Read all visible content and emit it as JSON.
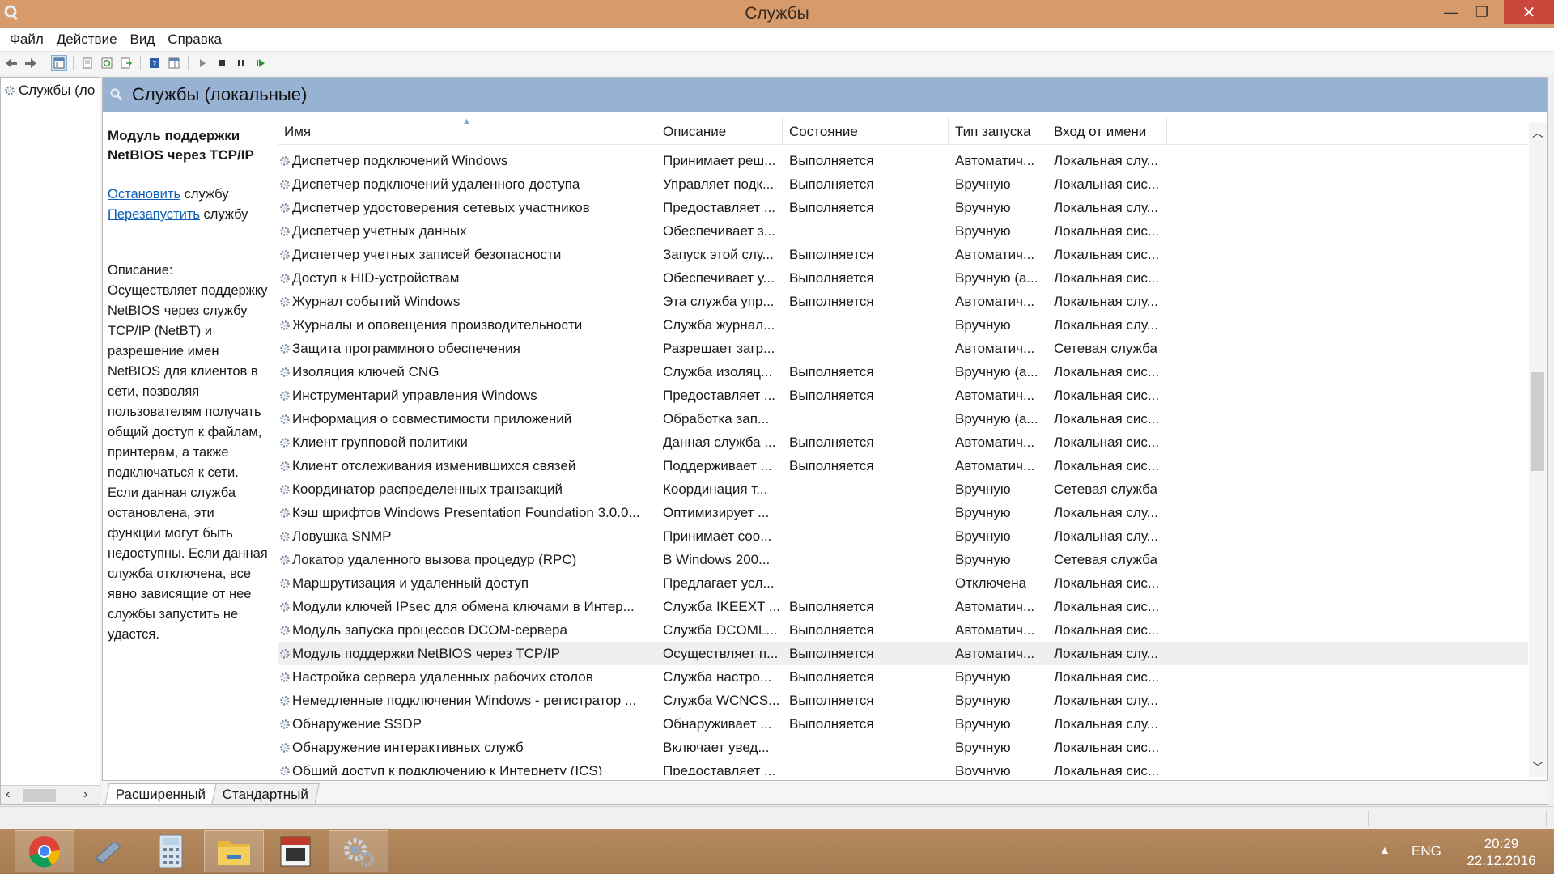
{
  "window": {
    "title": "Службы",
    "minimize_glyph": "—",
    "maximize_glyph": "❐",
    "close_glyph": "✕"
  },
  "menu": [
    "Файл",
    "Действие",
    "Вид",
    "Справка"
  ],
  "tree": {
    "item_label": "Службы (ло"
  },
  "main": {
    "header_title": "Службы (локальные)",
    "selected_service_title": "Модуль поддержки NetBIOS через TCP/IP",
    "stop_link": "Остановить",
    "stop_suffix": " службу",
    "restart_link": "Перезапустить",
    "restart_suffix": " службу",
    "description_label": "Описание:",
    "description_text": "Осуществляет поддержку NetBIOS через службу TCP/IP (NetBT) и разрешение имен NetBIOS для клиентов в сети, позволяя пользователям получать общий доступ к файлам, принтерам, а также подключаться к сети. Если данная служба остановлена, эти функции могут быть недоступны. Если данная служба отключена, все явно зависящие от нее службы запустить не удастся."
  },
  "table": {
    "columns": [
      "Имя",
      "Описание",
      "Состояние",
      "Тип запуска",
      "Вход от имени"
    ],
    "rows": [
      [
        "Диспетчер подключений Windows",
        "Принимает реш...",
        "Выполняется",
        "Автоматич...",
        "Локальная слу..."
      ],
      [
        "Диспетчер подключений удаленного доступа",
        "Управляет подк...",
        "Выполняется",
        "Вручную",
        "Локальная сис..."
      ],
      [
        "Диспетчер удостоверения сетевых участников",
        "Предоставляет ...",
        "Выполняется",
        "Вручную",
        "Локальная слу..."
      ],
      [
        "Диспетчер учетных данных",
        "Обеспечивает з...",
        "",
        "Вручную",
        "Локальная сис..."
      ],
      [
        "Диспетчер учетных записей безопасности",
        "Запуск этой слу...",
        "Выполняется",
        "Автоматич...",
        "Локальная сис..."
      ],
      [
        "Доступ к HID-устройствам",
        "Обеспечивает у...",
        "Выполняется",
        "Вручную (а...",
        "Локальная сис..."
      ],
      [
        "Журнал событий Windows",
        "Эта служба упр...",
        "Выполняется",
        "Автоматич...",
        "Локальная слу..."
      ],
      [
        "Журналы и оповещения производительности",
        "Служба журнал...",
        "",
        "Вручную",
        "Локальная слу..."
      ],
      [
        "Защита программного обеспечения",
        "Разрешает загр...",
        "",
        "Автоматич...",
        "Сетевая служба"
      ],
      [
        "Изоляция ключей CNG",
        "Служба изоляц...",
        "Выполняется",
        "Вручную (а...",
        "Локальная сис..."
      ],
      [
        "Инструментарий управления Windows",
        "Предоставляет ...",
        "Выполняется",
        "Автоматич...",
        "Локальная сис..."
      ],
      [
        "Информация о совместимости приложений",
        "Обработка зап...",
        "",
        "Вручную (а...",
        "Локальная сис..."
      ],
      [
        "Клиент групповой политики",
        "Данная служба ...",
        "Выполняется",
        "Автоматич...",
        "Локальная сис..."
      ],
      [
        "Клиент отслеживания изменившихся связей",
        "Поддерживает ...",
        "Выполняется",
        "Автоматич...",
        "Локальная сис..."
      ],
      [
        "Координатор распределенных транзакций",
        "Координация т...",
        "",
        "Вручную",
        "Сетевая служба"
      ],
      [
        "Кэш шрифтов Windows Presentation Foundation 3.0.0...",
        "Оптимизирует ...",
        "",
        "Вручную",
        "Локальная слу..."
      ],
      [
        "Ловушка SNMP",
        "Принимает соо...",
        "",
        "Вручную",
        "Локальная слу..."
      ],
      [
        "Локатор удаленного вызова процедур (RPC)",
        "В Windows 200...",
        "",
        "Вручную",
        "Сетевая служба"
      ],
      [
        "Маршрутизация и удаленный доступ",
        "Предлагает усл...",
        "",
        "Отключена",
        "Локальная сис..."
      ],
      [
        "Модули ключей IPsec для обмена ключами в Интер...",
        "Служба IKEEXT ...",
        "Выполняется",
        "Автоматич...",
        "Локальная сис..."
      ],
      [
        "Модуль запуска процессов DCOM-сервера",
        "Служба DCOML...",
        "Выполняется",
        "Автоматич...",
        "Локальная сис..."
      ],
      [
        "Модуль поддержки NetBIOS через TCP/IP",
        "Осуществляет п...",
        "Выполняется",
        "Автоматич...",
        "Локальная слу..."
      ],
      [
        "Настройка сервера удаленных рабочих столов",
        "Служба настро...",
        "Выполняется",
        "Вручную",
        "Локальная сис..."
      ],
      [
        "Немедленные подключения Windows - регистратор ...",
        "Служба WCNCS...",
        "Выполняется",
        "Вручную",
        "Локальная слу..."
      ],
      [
        "Обнаружение SSDP",
        "Обнаруживает ...",
        "Выполняется",
        "Вручную",
        "Локальная слу..."
      ],
      [
        "Обнаружение интерактивных служб",
        "Включает увед...",
        "",
        "Вручную",
        "Локальная сис..."
      ],
      [
        "Общий доступ к подключению к Интернету (ICS)",
        "Предоставляет ...",
        "",
        "Вручную",
        "Локальная сис..."
      ]
    ],
    "selected_row": 21
  },
  "tabs": [
    "Расширенный",
    "Стандартный"
  ],
  "taskbar": {
    "apps": [
      "chrome-icon",
      "explorer-drive-icon",
      "calculator-icon",
      "folder-icon",
      "calendar-icon",
      "services-gear-icon"
    ],
    "lang": "ENG",
    "time": "20:29",
    "date": "22.12.2016"
  },
  "colors": {
    "titlebar": "#d79a6b",
    "header": "#97b2d3",
    "close_button": "#c9473b",
    "link": "#0b5fb4"
  }
}
